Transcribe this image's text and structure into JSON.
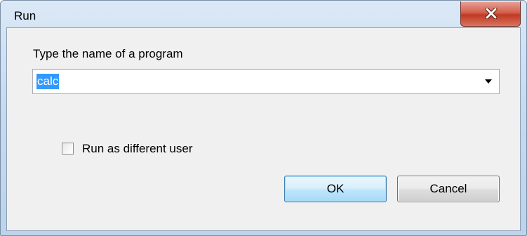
{
  "window": {
    "title": "Run",
    "close_icon": "close-icon"
  },
  "form": {
    "prompt_label": "Type the name of a program",
    "program_value": "calc",
    "program_value_selected": true,
    "dropdown_icon": "chevron-down-icon",
    "run_as_label": "Run as different user",
    "run_as_checked": false
  },
  "buttons": {
    "ok_label": "OK",
    "cancel_label": "Cancel"
  },
  "colors": {
    "selection": "#3399ff",
    "close_button": "#c8432b",
    "ok_border": "#3c7fb1"
  }
}
